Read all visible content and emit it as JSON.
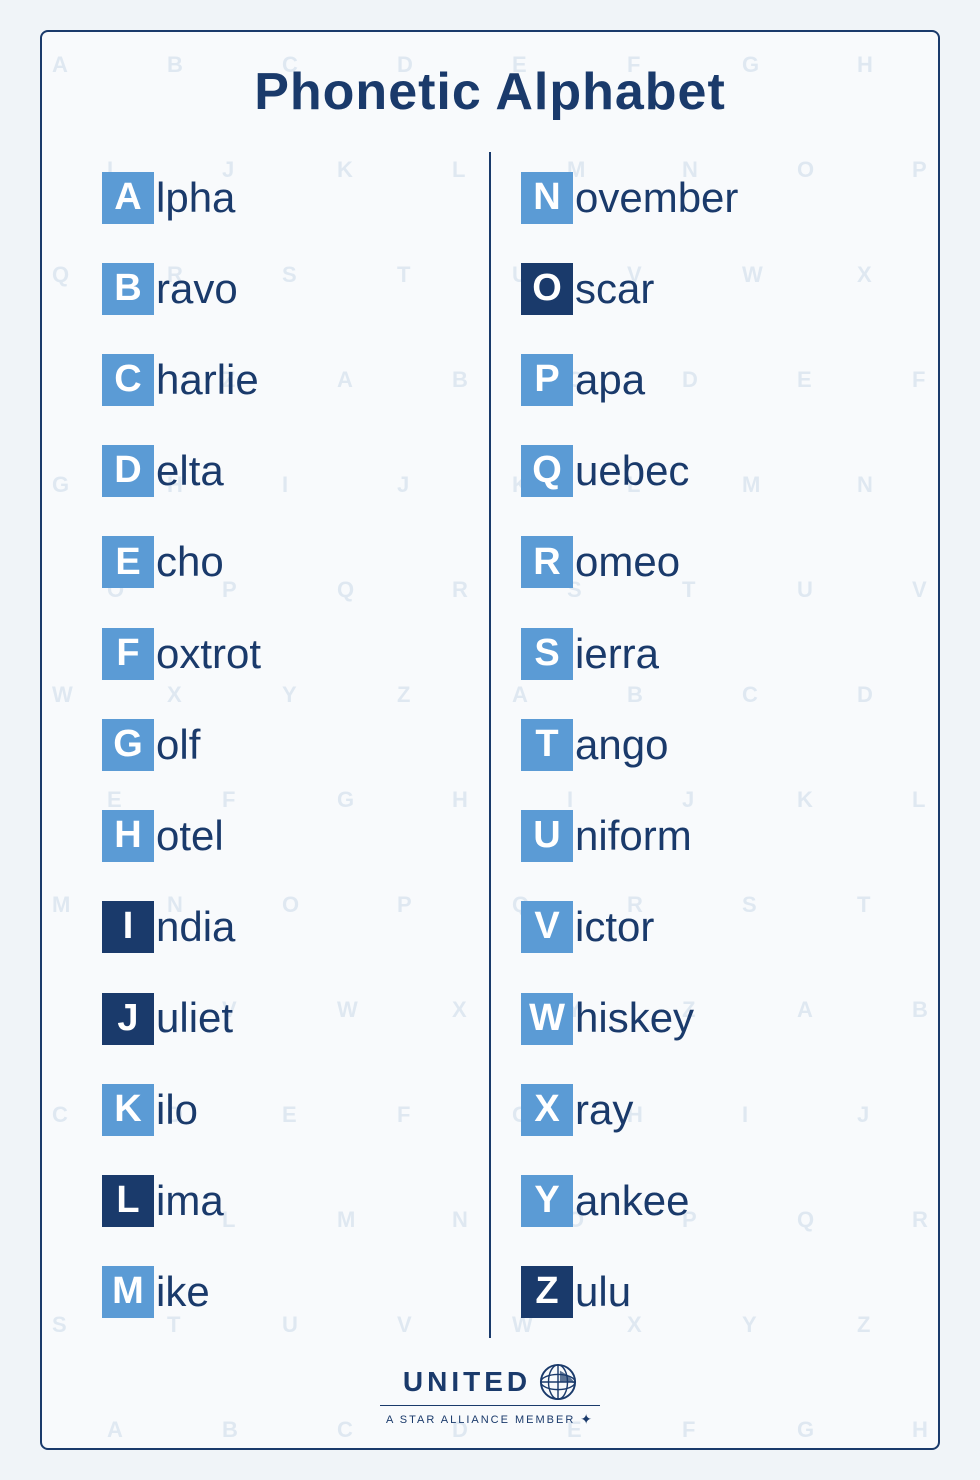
{
  "title": "Phonetic Alphabet",
  "left_column": [
    {
      "letter": "A",
      "word": "lpha",
      "shade": "light-blue"
    },
    {
      "letter": "B",
      "word": "ravo",
      "shade": "light-blue"
    },
    {
      "letter": "C",
      "word": "harlie",
      "shade": "light-blue"
    },
    {
      "letter": "D",
      "word": "elta",
      "shade": "light-blue"
    },
    {
      "letter": "E",
      "word": "cho",
      "shade": "light-blue"
    },
    {
      "letter": "F",
      "word": "oxtrot",
      "shade": "light-blue"
    },
    {
      "letter": "G",
      "word": "olf",
      "shade": "light-blue"
    },
    {
      "letter": "H",
      "word": "otel",
      "shade": "light-blue"
    },
    {
      "letter": "I",
      "word": "ndia",
      "shade": "dark-blue"
    },
    {
      "letter": "J",
      "word": "uliet",
      "shade": "dark-blue"
    },
    {
      "letter": "K",
      "word": "ilo",
      "shade": "light-blue"
    },
    {
      "letter": "L",
      "word": "ima",
      "shade": "dark-blue"
    },
    {
      "letter": "M",
      "word": "ike",
      "shade": "light-blue"
    }
  ],
  "right_column": [
    {
      "letter": "N",
      "word": "ovember",
      "shade": "light-blue"
    },
    {
      "letter": "O",
      "word": "scar",
      "shade": "dark-blue"
    },
    {
      "letter": "P",
      "word": "apa",
      "shade": "light-blue"
    },
    {
      "letter": "Q",
      "word": "uebec",
      "shade": "light-blue"
    },
    {
      "letter": "R",
      "word": "omeo",
      "shade": "light-blue"
    },
    {
      "letter": "S",
      "word": "ierra",
      "shade": "light-blue"
    },
    {
      "letter": "T",
      "word": "ango",
      "shade": "light-blue"
    },
    {
      "letter": "U",
      "word": "niform",
      "shade": "light-blue"
    },
    {
      "letter": "V",
      "word": "ictor",
      "shade": "light-blue"
    },
    {
      "letter": "W",
      "word": "hiskey",
      "shade": "light-blue"
    },
    {
      "letter": "X",
      "word": "ray",
      "shade": "light-blue"
    },
    {
      "letter": "Y",
      "word": "ankee",
      "shade": "light-blue"
    },
    {
      "letter": "Z",
      "word": "ulu",
      "shade": "dark-blue"
    }
  ],
  "footer": {
    "brand": "UNITED",
    "tagline": "A STAR ALLIANCE MEMBER"
  },
  "watermark_letters": [
    "A",
    "B",
    "C",
    "D",
    "E",
    "F",
    "G",
    "H",
    "I",
    "J",
    "K",
    "L",
    "M",
    "N",
    "O",
    "P",
    "Q",
    "R",
    "S",
    "T",
    "U",
    "V",
    "W",
    "X",
    "Y",
    "Z"
  ]
}
